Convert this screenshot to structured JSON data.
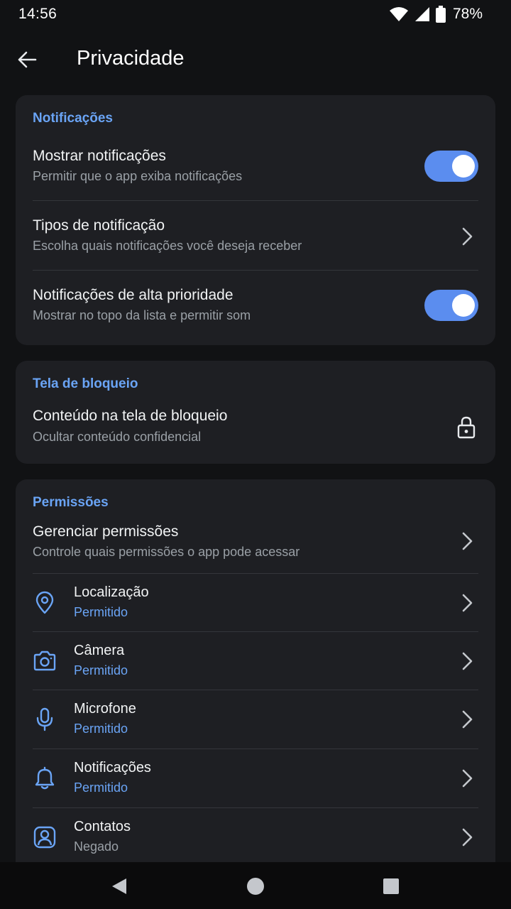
{
  "status_bar": {
    "time": "14:56",
    "battery": "78%"
  },
  "app_bar": {
    "title": "Privacidade"
  },
  "sections": {
    "notifications": {
      "header": "Notificações",
      "items": [
        {
          "title": "Mostrar notificações",
          "subtitle": "Permitir que o app exiba notificações",
          "control": "toggle",
          "on": true
        },
        {
          "title": "Tipos de notificação",
          "subtitle": "Escolha quais notificações você deseja receber",
          "control": "chevron"
        },
        {
          "title": "Notificações de alta prioridade",
          "subtitle": "Mostrar no topo da lista e permitir som",
          "control": "toggle",
          "on": true
        }
      ]
    },
    "lock_screen": {
      "header": "Tela de bloqueio",
      "items": [
        {
          "title": "Conteúdo na tela de bloqueio",
          "subtitle": "Ocultar conteúdo confidencial",
          "control": "lock-icon"
        }
      ]
    },
    "permissions": {
      "header": "Permissões",
      "manage": {
        "title": "Gerenciar permissões",
        "subtitle": "Controle quais permissões o app pode acessar"
      },
      "items": [
        {
          "title": "Localização",
          "status": "Permitido",
          "icon": "location-pin-icon"
        },
        {
          "title": "Câmera",
          "status": "Permitido",
          "icon": "camera-icon"
        },
        {
          "title": "Microfone",
          "status": "Permitido",
          "icon": "microphone-icon"
        },
        {
          "title": "Notificações",
          "status": "Permitido",
          "icon": "bell-icon"
        },
        {
          "title": "Contatos",
          "status": "Negado",
          "icon": "contact-icon"
        }
      ]
    }
  },
  "colors": {
    "accent": "#6aa4f5",
    "toggle_on": "#5b8def",
    "card": "#1e1f23",
    "background": "#111214",
    "denied": "#9aa0a6"
  }
}
